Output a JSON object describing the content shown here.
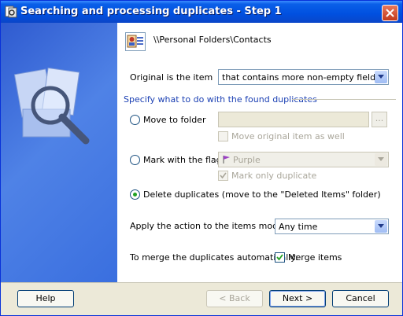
{
  "window": {
    "title": "Searching and processing duplicates - Step 1"
  },
  "folder": {
    "path": "\\\\Personal Folders\\Contacts"
  },
  "original": {
    "label": "Original is the item",
    "value": "that contains more non-empty fields"
  },
  "section": {
    "title": "Specify what to do with the found duplicates"
  },
  "move": {
    "label": "Move to folder",
    "also_label": "Move original item as well",
    "browse_label": "..."
  },
  "mark": {
    "label": "Mark with the flag",
    "flag_value": "Purple",
    "only_label": "Mark only duplicate"
  },
  "delete": {
    "label": "Delete duplicates (move to the \"Deleted Items\" folder)"
  },
  "apply": {
    "label": "Apply the action to the items modified",
    "value": "Any time"
  },
  "merge": {
    "label": "To merge the duplicates automatically:",
    "checkbox_label": "Merge items"
  },
  "buttons": {
    "help": "Help",
    "back": "< Back",
    "next": "Next >",
    "cancel": "Cancel"
  },
  "colors": {
    "title_bar": "#0a5fe8",
    "side_panel": "#3a6fdf",
    "flag": "#9b3fc4",
    "section_text": "#1a3fb3"
  },
  "icons": [
    "app-icon",
    "close-icon",
    "contact-folder-icon",
    "flag-icon",
    "chevron-down-icon"
  ]
}
